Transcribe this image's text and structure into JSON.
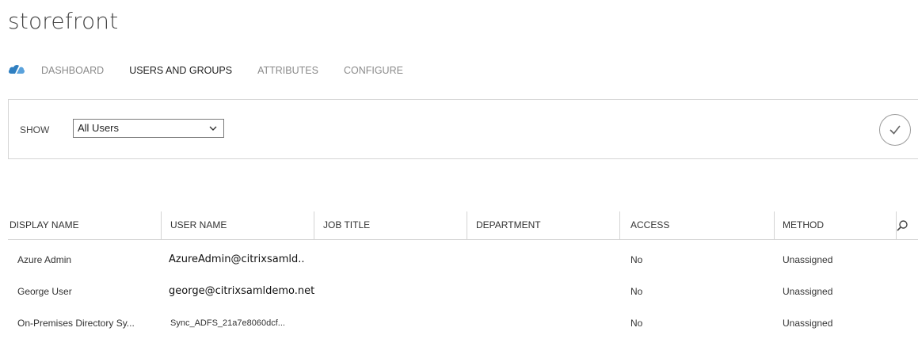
{
  "app": {
    "title": "storefront"
  },
  "nav": {
    "tabs": [
      {
        "label": "DASHBOARD",
        "active": false
      },
      {
        "label": "USERS AND GROUPS",
        "active": true
      },
      {
        "label": "ATTRIBUTES",
        "active": false
      },
      {
        "label": "CONFIGURE",
        "active": false
      }
    ],
    "icon": "azure-cloud-icon",
    "accent_color": "#2f7fc1"
  },
  "filter": {
    "show_label": "SHOW",
    "selected": "All Users"
  },
  "table": {
    "columns": [
      "DISPLAY NAME",
      "USER NAME",
      "JOB TITLE",
      "DEPARTMENT",
      "ACCESS",
      "METHOD"
    ],
    "rows": [
      {
        "display_name": "Azure Admin",
        "user_name": "AzureAdmin@citrixsamld..",
        "job_title": "",
        "department": "",
        "access": "No",
        "method": "Unassigned"
      },
      {
        "display_name": "George User",
        "user_name": "george@citrixsamldemo.net",
        "job_title": "",
        "department": "",
        "access": "No",
        "method": "Unassigned"
      },
      {
        "display_name": "On-Premises Directory Sy...",
        "user_name": "Sync_ADFS_21a7e8060dcf...",
        "job_title": "",
        "department": "",
        "access": "No",
        "method": "Unassigned"
      }
    ]
  }
}
